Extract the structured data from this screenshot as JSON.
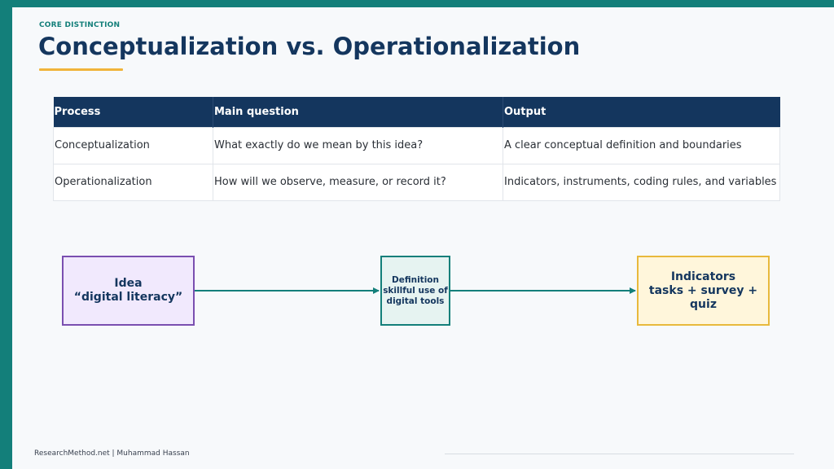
{
  "slide": {
    "eyebrow": "CORE DISTINCTION",
    "title": "Conceptualization vs. Operationalization"
  },
  "table": {
    "headers": [
      "Process",
      "Main question",
      "Output"
    ],
    "rows": [
      [
        "Conceptualization",
        "What exactly do we mean by this idea?",
        "A clear conceptual definition and boundaries"
      ],
      [
        "Operationalization",
        "How will we observe, measure, or record it?",
        "Indicators, instruments, coding rules, and variables"
      ]
    ]
  },
  "flow": {
    "idea": {
      "line1": "Idea",
      "line2": "“digital literacy”"
    },
    "definition": {
      "line1": "Definition",
      "line2": "skillful use of",
      "line3": "digital tools"
    },
    "indicators": {
      "line1": "Indicators",
      "line2": "tasks + survey + quiz"
    }
  },
  "footer": {
    "text": "ResearchMethod.net | Muhammad Hassan"
  },
  "colors": {
    "accent_teal": "#137f7a",
    "navy": "#14365e",
    "gold": "#f0b43a",
    "idea_fill": "#f1e9fd",
    "idea_border": "#7a4fb0",
    "definition_fill": "#e6f3f1",
    "indicators_fill": "#fff6db",
    "indicators_border": "#e8b93c"
  }
}
